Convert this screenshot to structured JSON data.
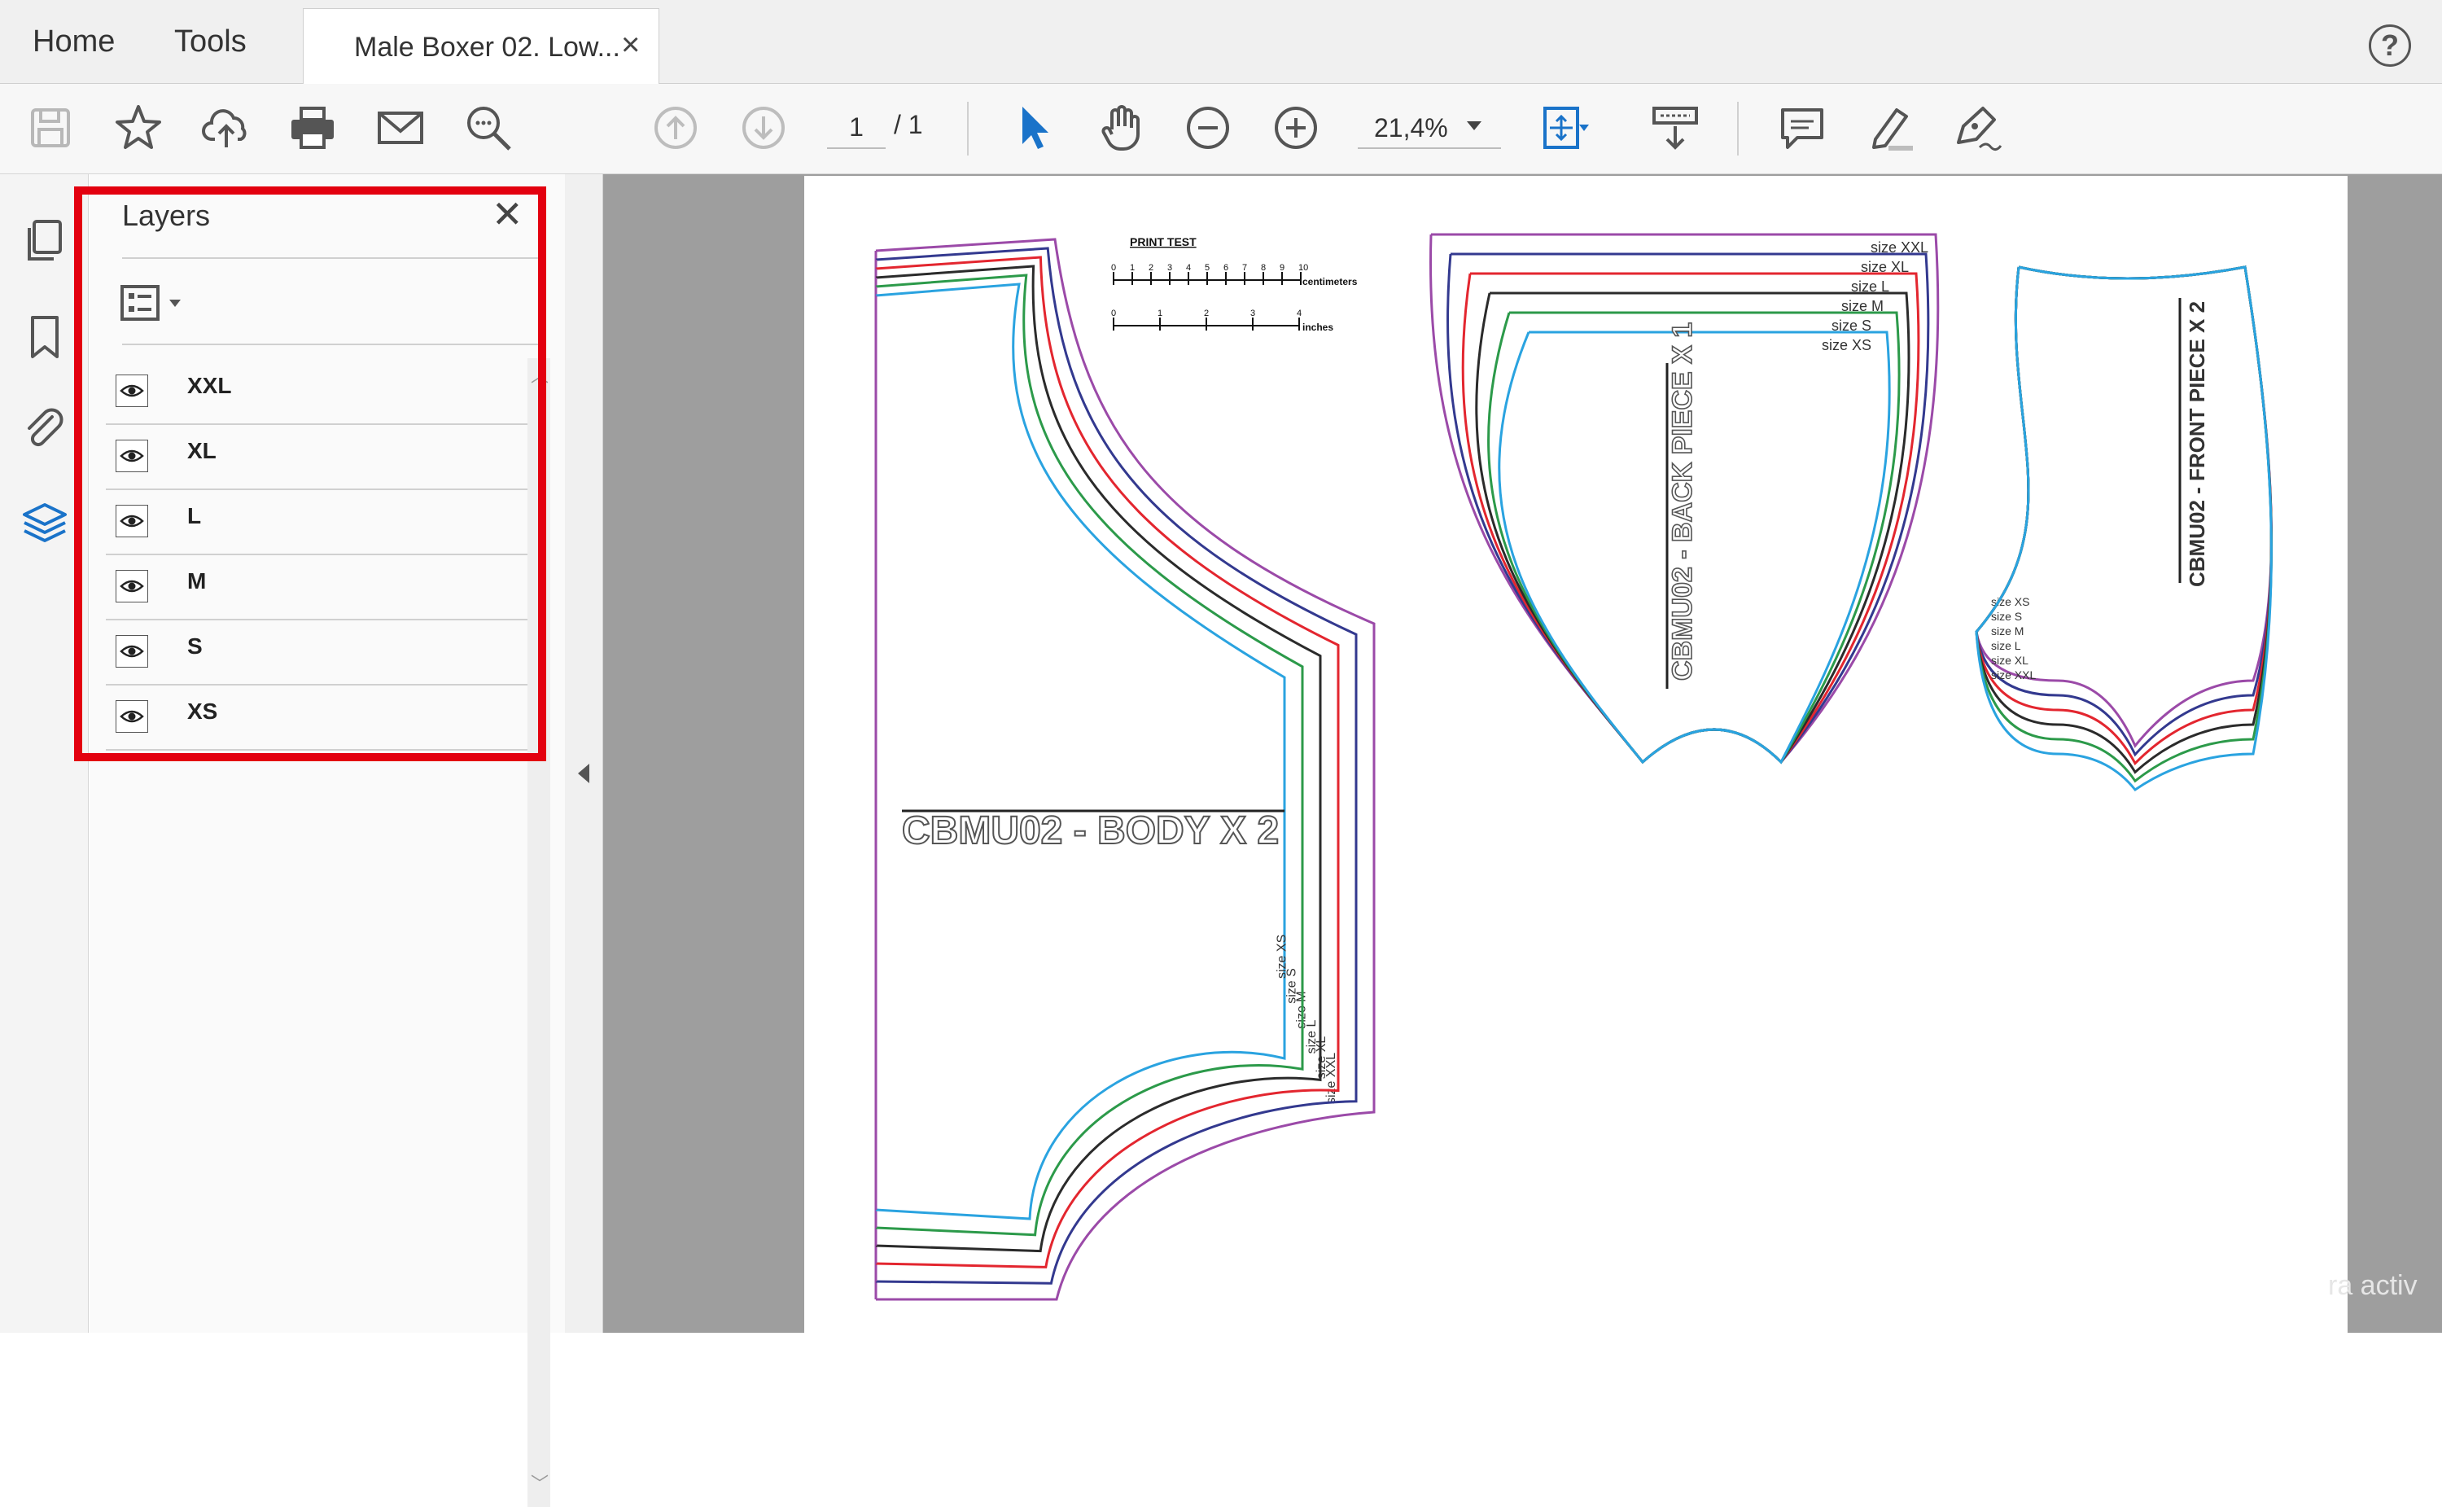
{
  "tabs": {
    "home": "Home",
    "tools": "Tools",
    "document_title": "Male Boxer 02. Low...",
    "close_glyph": "×"
  },
  "help_glyph": "?",
  "toolbar": {
    "page_current": "1",
    "page_total": "/ 1",
    "zoom": "21,4%"
  },
  "layers": {
    "title": "Layers",
    "close_glyph": "✕",
    "items": [
      {
        "name": "XXL",
        "visible": true
      },
      {
        "name": "XL",
        "visible": true
      },
      {
        "name": "L",
        "visible": true
      },
      {
        "name": "M",
        "visible": true
      },
      {
        "name": "S",
        "visible": true
      },
      {
        "name": "XS",
        "visible": true
      }
    ]
  },
  "pattern": {
    "print_test": "PRINT TEST",
    "centimeters": "centimeters",
    "inches": "inches",
    "cm_ticks": [
      "0",
      "1",
      "2",
      "3",
      "4",
      "5",
      "6",
      "7",
      "8",
      "9",
      "10"
    ],
    "inch_ticks": [
      "0",
      "1",
      "2",
      "3",
      "4"
    ],
    "body_label": "CBMU02 - BODY X 2",
    "back_label": "CBMU02 - BACK PIECE X 1",
    "front_label": "CBMU02 - FRONT PIECE X 2",
    "size_prefix": "size",
    "sizes_desc": [
      "XXL",
      "XL",
      "L",
      "M",
      "S",
      "XS"
    ],
    "sizes_asc": [
      "XS",
      "S",
      "M",
      "L",
      "XL",
      "XXL"
    ]
  },
  "watermark": "ra activ",
  "colors": {
    "highlight": "#e3000f",
    "accent_blue": "#1a73c9",
    "size_xxl": "#9b4aa8",
    "size_xl": "#33398f",
    "size_l": "#e3262f",
    "size_m": "#2b2b2b",
    "size_s": "#2c9a4a",
    "size_xs": "#2aa3e0"
  },
  "icons": [
    "save-icon",
    "star-icon",
    "cloud-upload-icon",
    "print-icon",
    "mail-icon",
    "search-icon",
    "arrow-up-icon",
    "arrow-down-icon",
    "select-cursor-icon",
    "hand-icon",
    "zoom-out-icon",
    "zoom-in-icon",
    "fit-page-icon",
    "scroll-mode-icon",
    "comment-icon",
    "highlight-icon",
    "sign-icon",
    "pages-icon",
    "bookmark-icon",
    "attachment-icon",
    "layers-icon",
    "eye-icon"
  ]
}
